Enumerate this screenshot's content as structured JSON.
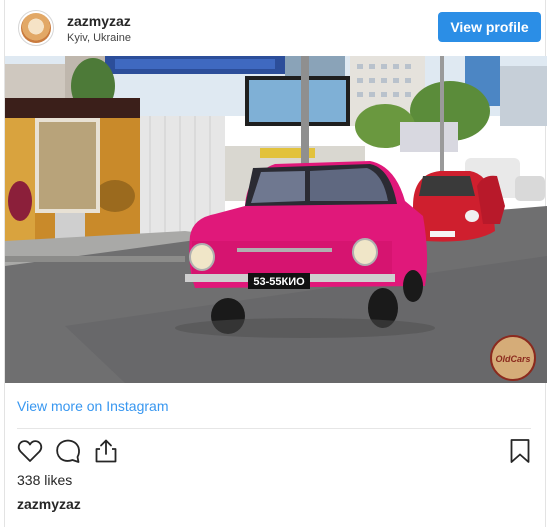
{
  "post": {
    "username": "zazmyzaz",
    "location": "Kyiv, Ukraine",
    "view_profile_label": "View profile",
    "view_more_label": "View more on Instagram",
    "likes_text": "338 likes",
    "caption_username": "zazmyzaz"
  },
  "photo": {
    "license_plate": "53-55КИО",
    "watermark_text": "OldCars"
  },
  "icons": {
    "like": "heart-icon",
    "comment": "comment-icon",
    "share": "share-icon",
    "save": "bookmark-icon"
  },
  "colors": {
    "accent_button": "#2b8ee6",
    "link": "#3897f0"
  }
}
